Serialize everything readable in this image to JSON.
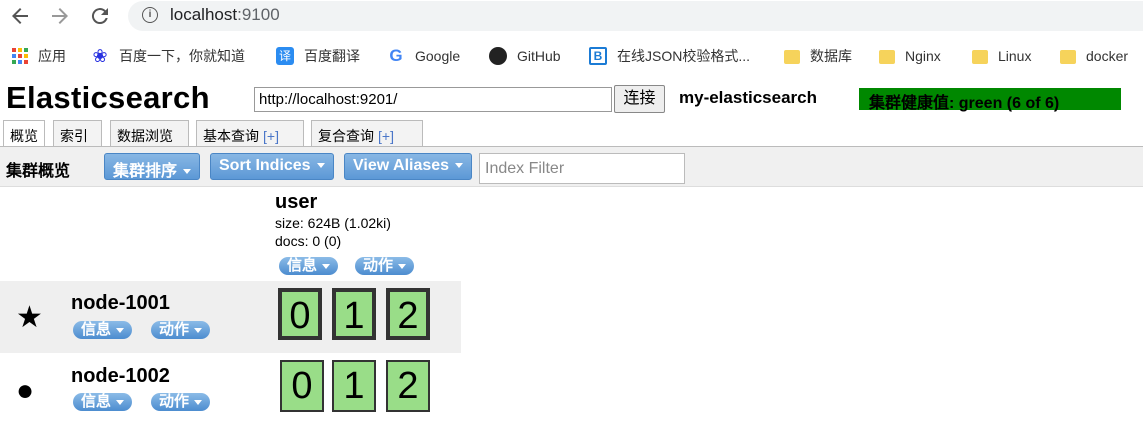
{
  "browser": {
    "url_host": "localhost",
    "url_port": ":9100",
    "icons": {
      "back": "back-arrow-icon",
      "forward": "forward-arrow-icon",
      "reload": "reload-icon",
      "info": "info-icon"
    }
  },
  "bookmarks": [
    {
      "label": "应用",
      "icon": "apps-grid-icon"
    },
    {
      "label": "百度一下，你就知道",
      "icon": "baidu-paw-icon"
    },
    {
      "label": "百度翻译",
      "icon": "translate-icon",
      "glyph": "译"
    },
    {
      "label": "Google",
      "icon": "google-icon",
      "glyph": "G"
    },
    {
      "label": "GitHub",
      "icon": "github-icon"
    },
    {
      "label": "在线JSON校验格式...",
      "icon": "json-b-icon",
      "glyph": "B"
    },
    {
      "label": "数据库",
      "icon": "folder-icon"
    },
    {
      "label": "Nginx",
      "icon": "folder-icon"
    },
    {
      "label": "Linux",
      "icon": "folder-icon"
    },
    {
      "label": "docker",
      "icon": "folder-icon"
    }
  ],
  "header": {
    "brand": "Elasticsearch",
    "connect_url": "http://localhost:9201/",
    "connect_label": "连接",
    "cluster_name": "my-elasticsearch",
    "health": "集群健康值: green (6 of 6)",
    "health_color": "#008800"
  },
  "tabs": [
    {
      "label": "概览",
      "plus": ""
    },
    {
      "label": "索引",
      "plus": ""
    },
    {
      "label": "数据浏览",
      "plus": ""
    },
    {
      "label": "基本查询",
      "plus": "[+]"
    },
    {
      "label": "复合查询",
      "plus": "[+]"
    }
  ],
  "toolbar": {
    "title": "集群概览",
    "sort_cluster": "集群排序",
    "sort_indices": "Sort Indices",
    "view_aliases": "View Aliases",
    "filter_placeholder": "Index Filter"
  },
  "index": {
    "name": "user",
    "size": "size: 624B (1.02ki)",
    "docs": "docs: 0 (0)",
    "info_label": "信息",
    "action_label": "动作"
  },
  "nodes": [
    {
      "name": "node-1001",
      "icon": "star-icon",
      "glyph": "★",
      "master": true,
      "info_label": "信息",
      "action_label": "动作",
      "shards": [
        "0",
        "1",
        "2"
      ],
      "shard_type": "primary"
    },
    {
      "name": "node-1002",
      "icon": "circle-icon",
      "glyph": "●",
      "master": false,
      "info_label": "信息",
      "action_label": "动作",
      "shards": [
        "0",
        "1",
        "2"
      ],
      "shard_type": "replica"
    }
  ],
  "colors": {
    "shard_fill": "#99dd88",
    "button_blue": "#5c98d6"
  }
}
